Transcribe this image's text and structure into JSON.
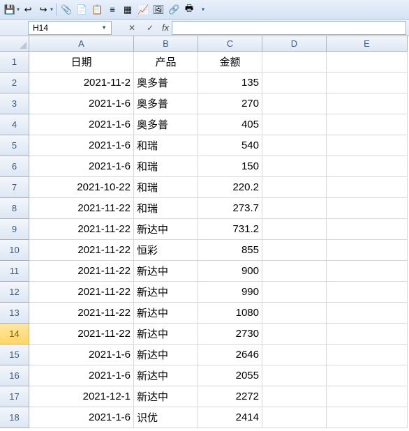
{
  "namebox": "H14",
  "formula": "",
  "columns": [
    "A",
    "B",
    "C",
    "D",
    "E"
  ],
  "colWidths": [
    "col-A",
    "col-B",
    "col-C",
    "col-D",
    "col-E"
  ],
  "activeRow": 14,
  "headers": {
    "A": "日期",
    "B": "产品",
    "C": "金额"
  },
  "rows": [
    {
      "n": 1,
      "A": "日期",
      "B": "产品",
      "C": "金额",
      "aA": "center",
      "aB": "center",
      "aC": "center"
    },
    {
      "n": 2,
      "A": "2021-11-2",
      "B": "奥多普",
      "C": "135",
      "aA": "right",
      "aB": "left",
      "aC": "right"
    },
    {
      "n": 3,
      "A": "2021-1-6",
      "B": "奥多普",
      "C": "270",
      "aA": "right",
      "aB": "left",
      "aC": "right"
    },
    {
      "n": 4,
      "A": "2021-1-6",
      "B": "奥多普",
      "C": "405",
      "aA": "right",
      "aB": "left",
      "aC": "right"
    },
    {
      "n": 5,
      "A": "2021-1-6",
      "B": "和瑞",
      "C": "540",
      "aA": "right",
      "aB": "left",
      "aC": "right"
    },
    {
      "n": 6,
      "A": "2021-1-6",
      "B": "和瑞",
      "C": "150",
      "aA": "right",
      "aB": "left",
      "aC": "right"
    },
    {
      "n": 7,
      "A": "2021-10-22",
      "B": "和瑞",
      "C": "220.2",
      "aA": "right",
      "aB": "left",
      "aC": "right"
    },
    {
      "n": 8,
      "A": "2021-11-22",
      "B": "和瑞",
      "C": "273.7",
      "aA": "right",
      "aB": "left",
      "aC": "right"
    },
    {
      "n": 9,
      "A": "2021-11-22",
      "B": "新达中",
      "C": "731.2",
      "aA": "right",
      "aB": "left",
      "aC": "right"
    },
    {
      "n": 10,
      "A": "2021-11-22",
      "B": "恒彩",
      "C": "855",
      "aA": "right",
      "aB": "left",
      "aC": "right"
    },
    {
      "n": 11,
      "A": "2021-11-22",
      "B": "新达中",
      "C": "900",
      "aA": "right",
      "aB": "left",
      "aC": "right"
    },
    {
      "n": 12,
      "A": "2021-11-22",
      "B": "新达中",
      "C": "990",
      "aA": "right",
      "aB": "left",
      "aC": "right"
    },
    {
      "n": 13,
      "A": "2021-11-22",
      "B": "新达中",
      "C": "1080",
      "aA": "right",
      "aB": "left",
      "aC": "right"
    },
    {
      "n": 14,
      "A": "2021-11-22",
      "B": "新达中",
      "C": "2730",
      "aA": "right",
      "aB": "left",
      "aC": "right"
    },
    {
      "n": 15,
      "A": "2021-1-6",
      "B": "新达中",
      "C": "2646",
      "aA": "right",
      "aB": "left",
      "aC": "right"
    },
    {
      "n": 16,
      "A": "2021-1-6",
      "B": "新达中",
      "C": "2055",
      "aA": "right",
      "aB": "left",
      "aC": "right"
    },
    {
      "n": 17,
      "A": "2021-12-1",
      "B": "新达中",
      "C": "2272",
      "aA": "right",
      "aB": "left",
      "aC": "right"
    },
    {
      "n": 18,
      "A": "2021-1-6",
      "B": "识优",
      "C": "2414",
      "aA": "right",
      "aB": "left",
      "aC": "right"
    }
  ],
  "toolbarIcons": [
    {
      "name": "save-icon",
      "glyph": "💾"
    },
    {
      "name": "undo-icon",
      "glyph": "↩"
    },
    {
      "name": "redo-icon",
      "glyph": "↪"
    },
    {
      "name": "attach-icon",
      "glyph": "📎"
    },
    {
      "name": "new-doc-icon",
      "glyph": "📄"
    },
    {
      "name": "paste-icon",
      "glyph": "📋"
    },
    {
      "name": "format-icon",
      "glyph": "≡"
    },
    {
      "name": "table-icon",
      "glyph": "▦"
    },
    {
      "name": "chart-icon",
      "glyph": "📈"
    },
    {
      "name": "image-icon",
      "glyph": "🖼"
    },
    {
      "name": "link-icon",
      "glyph": "🔗"
    },
    {
      "name": "print-icon",
      "glyph": "🖶"
    }
  ]
}
